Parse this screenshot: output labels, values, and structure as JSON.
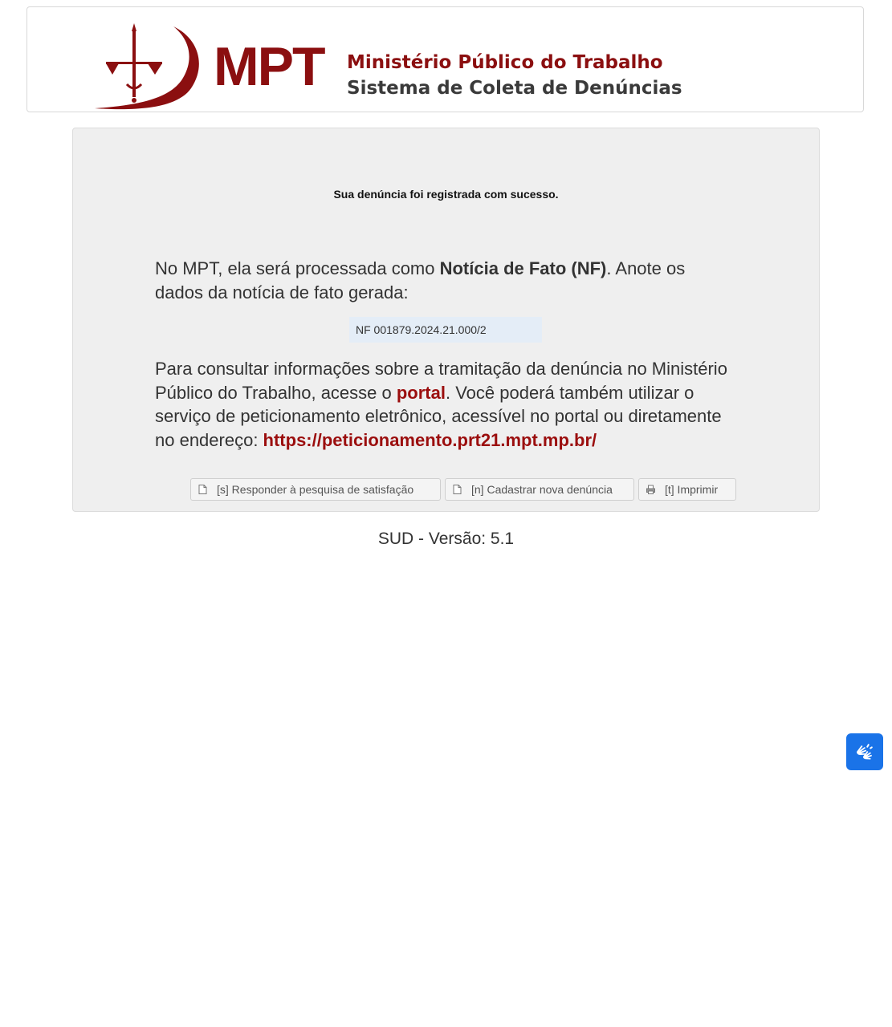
{
  "header": {
    "logo_abbr": "MPT",
    "logo_line1": "Ministério Público do Trabalho",
    "logo_line2": "Sistema de Coleta de Denúncias"
  },
  "panel": {
    "success_message": "Sua denúncia foi registrada com sucesso.",
    "para1_before": "No MPT, ela será processada como ",
    "para1_bold": "Notícia de Fato (NF)",
    "para1_after": ". Anote os dados da notícia de fato gerada:",
    "nf_number": "NF 001879.2024.21.000/2",
    "para2_before": "Para consultar informações sobre a tramitação da denúncia no Ministério Público do Trabalho, acesse o ",
    "portal_link": "portal",
    "para2_middle": ". Você poderá também utilizar o serviço de peticionamento eletrônico, acessível no portal ou diretamente no endereço: ",
    "peticionamento_link": "https://peticionamento.prt21.mpt.mp.br/"
  },
  "buttons": {
    "survey": "[s] Responder à pesquisa de satisfação",
    "new_complaint": "[n] Cadastrar nova denúncia",
    "print": "[t] Imprimir"
  },
  "footer": {
    "version": "SUD - Versão: 5.1"
  },
  "colors": {
    "brand_red": "#8b0f10",
    "link_red": "#9b0e0e",
    "panel_bg": "#efefef",
    "nf_bg": "#e4edf7",
    "vlibras_blue": "#1a73e8"
  },
  "icons": {
    "survey_button": "document-icon",
    "new_complaint_button": "document-icon",
    "print_button": "printer-icon",
    "accessibility": "sign-language-hands-icon"
  }
}
